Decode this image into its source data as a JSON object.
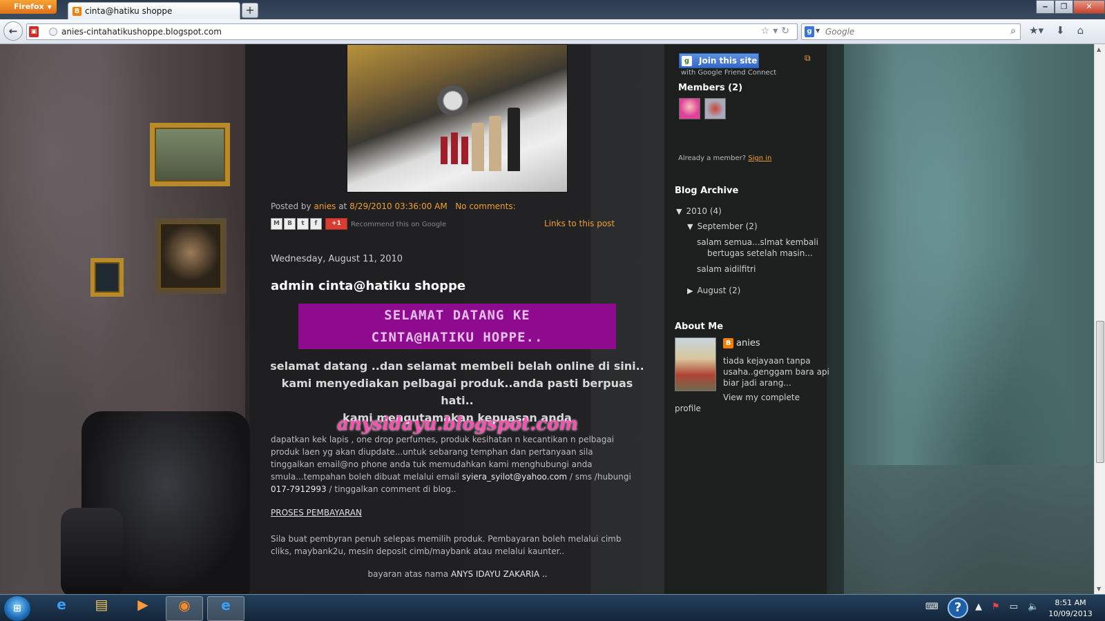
{
  "browser": {
    "menu_button": "Firefox",
    "tab_title": "cinta@hatiku shoppe",
    "new_tab": "+",
    "url": "anies-cintahatikushoppe.blogspot.com",
    "search_placeholder": "Google",
    "window_buttons": [
      "‒",
      "❐",
      "✕"
    ]
  },
  "post": {
    "meta_prefix": "Posted by",
    "author": "anies",
    "at": "at",
    "timestamp": "8/29/2010 03:36:00 AM",
    "comments": "No comments:",
    "recommend": "Recommend this on Google",
    "links_to_post": "Links to this post",
    "share_buttons": [
      "M",
      "B",
      "t",
      "f"
    ],
    "gplus": "+1"
  },
  "post2": {
    "date": "Wednesday, August 11, 2010",
    "title": "admin cinta@hatiku shoppe",
    "welcome_line1": "SELAMAT DATANG KE",
    "welcome_line2": "CINTA@HATIKU HOPPE..",
    "intro_line1": "selamat datang ..dan selamat membeli belah online di sini..",
    "intro_line2": "kami menyediakan pelbagai produk..anda pasti berpuas  hati..",
    "intro_line3": "kami mengutamakan kepuasan anda",
    "watermark": "anysidayu.blogspot.com",
    "body_part1": "dapatkan kek lapis , one drop perfumes, produk kesihatan n kecantikan n pelbagai produk laen yg akan diupdate...untuk sebarang temphan dan pertanyaan sila tinggalkan email@no phone anda tuk memudahkan kami menghubungi anda smula...tempahan boleh dibuat melalui email ",
    "email": "syiera_syilot@yahoo.com",
    "body_part2": " / sms /hubungi ",
    "phone": "017-7912993",
    "body_part3": " / tinggalkan comment di blog..",
    "proses": "PROSES PEMBAYARAN",
    "payment": "Sila buat pembyran penuh selepas memilih produk. Pembayaran boleh melalui cimb cliks, maybank2u, mesin deposit cimb/maybank atau melalui kaunter..",
    "bayaran_prefix": "bayaran atas nama ",
    "bayaran_name": "ANYS IDAYU ZAKARIA ..",
    "bayaran_suffix": ""
  },
  "sidebar": {
    "join_button": "Join this site",
    "join_sub": "with Google Friend Connect",
    "members_title": "Members (2)",
    "already_member": "Already a member? ",
    "sign_in": "Sign in",
    "archive_title": "Blog Archive",
    "year": "2010",
    "year_count": "(4)",
    "september": "September",
    "september_count": "(2)",
    "post_1_line1": "salam semua...slmat kembali",
    "post_1_line2": "bertugas setelah masin...",
    "post_2": "salam aidilfitri",
    "august": "August",
    "august_count": "(2)",
    "about_title": "About Me",
    "about_name": "anies",
    "about_desc": "tiada kejayaan tanpa usaha..genggam bara api biar jadi arang...",
    "view_profile_1": "View my complete",
    "view_profile_2": "profile"
  },
  "taskbar": {
    "clock_time": "8:51 AM",
    "clock_date": "10/09/2013"
  },
  "colors": {
    "accent_orange": "#f0a030",
    "welcome_box": "#8e0a8e",
    "watermark_pink": "#ff4fb0"
  }
}
